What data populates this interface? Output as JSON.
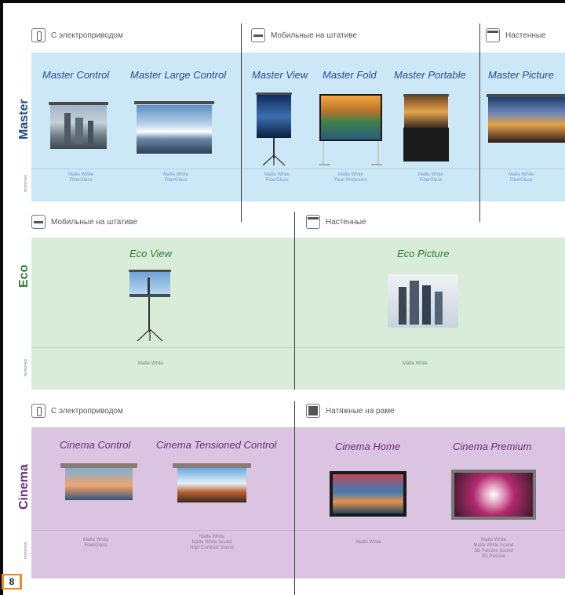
{
  "page_number": "8",
  "sections": {
    "master": {
      "label": "Master",
      "polotno": "полотно",
      "categories": [
        "С электроприводом",
        "Мобильные на штативе",
        "Настенные"
      ],
      "products": [
        {
          "title": "Master Control",
          "materials": [
            "Matte White",
            "FiberGlass"
          ]
        },
        {
          "title": "Master Large Control",
          "materials": [
            "Matte White",
            "FiberGlass"
          ]
        },
        {
          "title": "Master View",
          "materials": [
            "Matte White",
            "FiberGlass"
          ]
        },
        {
          "title": "Master Fold",
          "materials": [
            "Matte White",
            "Rear Projection"
          ]
        },
        {
          "title": "Master Portable",
          "materials": [
            "Matte White",
            "FiberGlass"
          ]
        },
        {
          "title": "Master Picture",
          "materials": [
            "Matte White",
            "FiberGlass"
          ]
        }
      ]
    },
    "eco": {
      "label": "Eco",
      "polotno": "полотно",
      "categories": [
        "Мобильные на штативе",
        "Настенные"
      ],
      "products": [
        {
          "title": "Eco View",
          "materials": [
            "Matte White"
          ]
        },
        {
          "title": "Eco Picture",
          "materials": [
            "Matte White"
          ]
        }
      ]
    },
    "cinema": {
      "label": "Cinema",
      "polotno": "полотно",
      "categories": [
        "С электроприводом",
        "Натяжные на раме"
      ],
      "products": [
        {
          "title": "Cinema Control",
          "materials": [
            "Matte White",
            "FiberGlass"
          ]
        },
        {
          "title": "Cinema Tensioned Control",
          "materials": [
            "Matte White",
            "Matte White Sound",
            "High Contrast Sound"
          ]
        },
        {
          "title": "Cinema Home",
          "materials": [
            "Matte White"
          ]
        },
        {
          "title": "Cinema Premium",
          "materials": [
            "Matte White",
            "Matte White Sound",
            "3D Passive Sound",
            "3D Passive"
          ]
        }
      ]
    }
  },
  "colors": {
    "master": "#1f4f7f",
    "eco": "#2e7a38",
    "cinema": "#6c2a79",
    "page_tab": "#f28a1a"
  },
  "icons": [
    "remote-control-icon",
    "tripod-case-icon",
    "wall-screen-icon",
    "frame-screen-icon"
  ]
}
